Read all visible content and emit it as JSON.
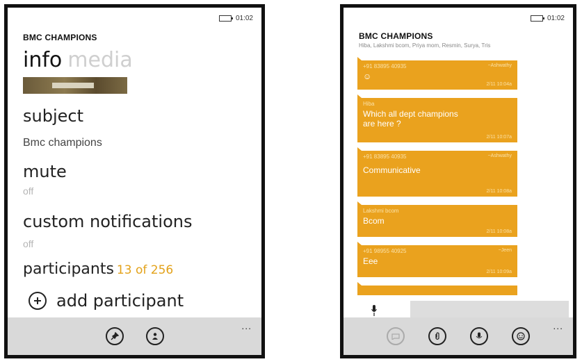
{
  "left": {
    "status_time": "01:02",
    "group_title": "BMC CHAMPIONS",
    "pivot_active": "info",
    "pivot_inactive": "media",
    "subject_label": "subject",
    "subject_value": "Bmc champions",
    "mute_label": "mute",
    "mute_value": "off",
    "notifications_label": "custom notifications",
    "notifications_value": "off",
    "participants_label": "participants",
    "participants_count": "13 of 256",
    "add_participant_label": "add participant",
    "appbar_more": "..."
  },
  "right": {
    "status_time": "01:02",
    "group_title": "BMC CHAMPIONS",
    "participants_line": "Hiba, Lakshmi bcom, Priya mom, Resmin, Surya, Tris",
    "messages": [
      {
        "sender": "+91 83895 40935",
        "meta": "~Ashwathy",
        "text": "",
        "time": "2/11 10:04a"
      },
      {
        "sender": "Hiba",
        "meta": "",
        "text": "Which all dept champions are here ?",
        "time": "2/11 10:07a"
      },
      {
        "sender": "+91 83895 40935",
        "meta": "~Ashwathy",
        "text": "Communicative",
        "time": "2/11 10:08a"
      },
      {
        "sender": "Lakshmi bcom",
        "meta": "",
        "text": "Bcom",
        "time": "2/11 10:08a"
      },
      {
        "sender": "+91 98955 40925",
        "meta": "~Jeen",
        "text": "Eee",
        "time": "2/11 10:09a"
      }
    ],
    "appbar_more": "..."
  },
  "colors": {
    "accent": "#eaa21e",
    "count": "#e3a21a",
    "appbar": "#d9d9d9"
  }
}
